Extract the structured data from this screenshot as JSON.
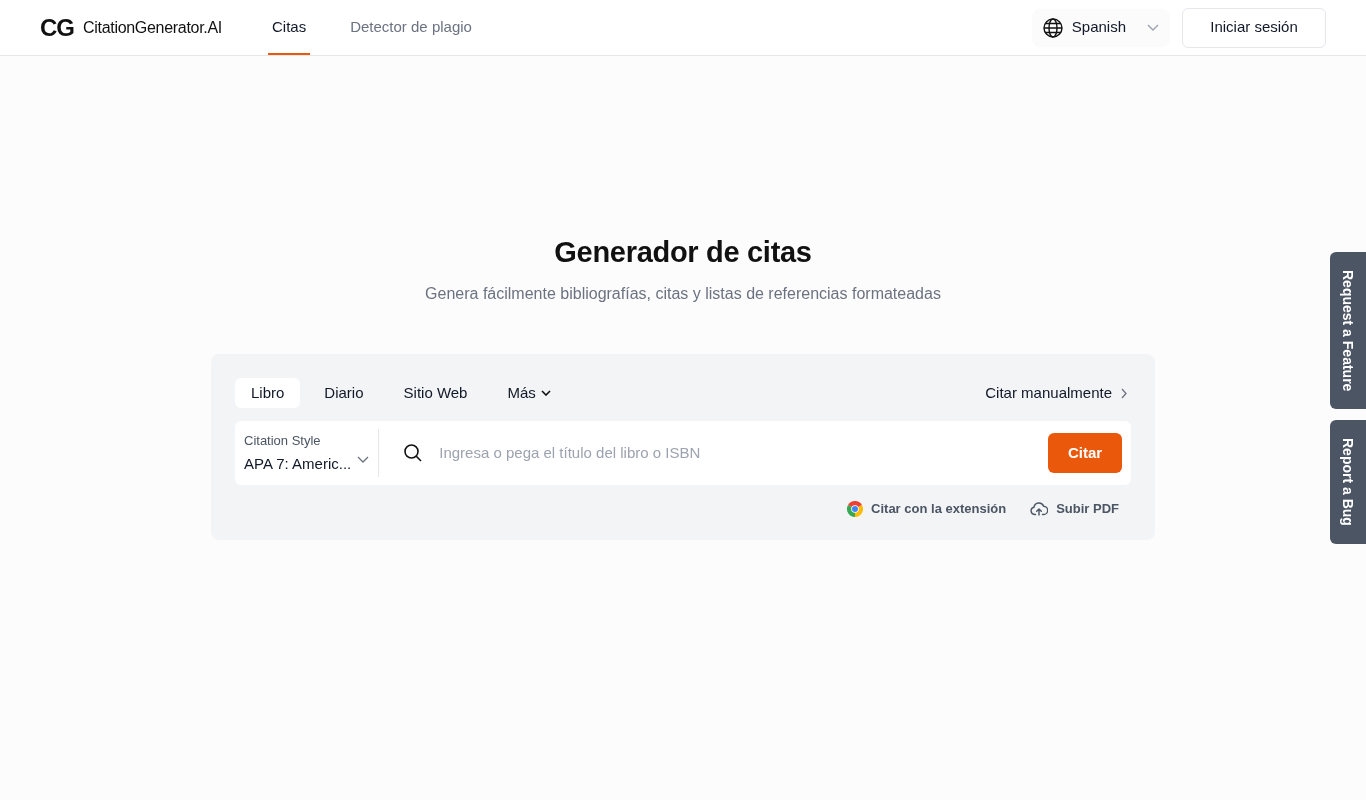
{
  "header": {
    "logo": {
      "mark": "CG",
      "text": "CitationGenerator.AI"
    },
    "nav": [
      {
        "label": "Citas",
        "selected": true
      },
      {
        "label": "Detector de plagio",
        "selected": false
      }
    ],
    "language": {
      "label": "Spanish"
    },
    "login_button": "Iniciar sesión"
  },
  "hero": {
    "title": "Generador de citas",
    "subtitle": "Genera fácilmente bibliografías, citas y listas de referencias formateadas"
  },
  "citation_panel": {
    "source_tabs": [
      {
        "label": "Libro",
        "selected": true,
        "kind": "tab"
      },
      {
        "label": "Diario",
        "selected": false,
        "kind": "tab"
      },
      {
        "label": "Sitio Web",
        "selected": false,
        "kind": "tab"
      },
      {
        "label": "Más",
        "selected": false,
        "kind": "menu"
      }
    ],
    "manual_link": "Citar manualmente",
    "style_select": {
      "label": "Citation Style",
      "value": "APA 7: Americ..."
    },
    "search": {
      "placeholder": "Ingresa o pega el título del libro o ISBN"
    },
    "cite_button": "Citar",
    "actions": [
      {
        "label": "Citar con la extensión",
        "kind": "chrome"
      },
      {
        "label": "Subir PDF",
        "kind": "upload"
      }
    ]
  },
  "side_tabs": [
    {
      "label": "Request a Feature"
    },
    {
      "label": "Report a Bug"
    }
  ]
}
